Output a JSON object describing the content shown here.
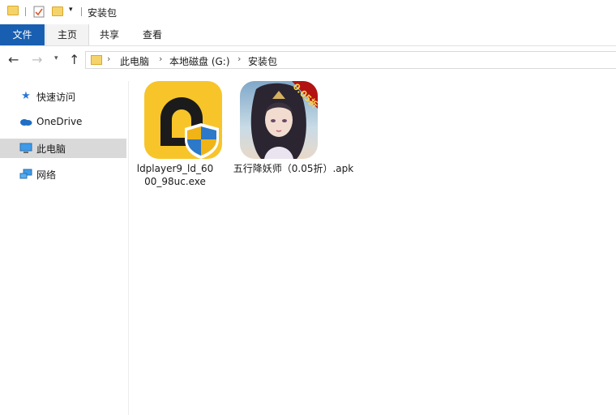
{
  "window": {
    "title": "安装包"
  },
  "ribbon": {
    "tabs": [
      "文件",
      "主页",
      "共享",
      "查看"
    ]
  },
  "address": {
    "crumbs": [
      "此电脑",
      "本地磁盘 (G:)",
      "安装包"
    ]
  },
  "sidebar": {
    "items": [
      {
        "label": "快速访问",
        "icon": "star-pin-icon"
      },
      {
        "label": "OneDrive",
        "icon": "cloud-icon"
      },
      {
        "label": "此电脑",
        "icon": "computer-icon",
        "selected": true
      },
      {
        "label": "网络",
        "icon": "network-icon"
      }
    ]
  },
  "files": [
    {
      "name": "ldplayer9_ld_6000_98uc.exe",
      "line1": "ldplayer9_ld_60",
      "line2": "00_98uc.exe",
      "icon": "ldplayer-app-icon"
    },
    {
      "name": "五行降妖师（0.05折）.apk",
      "line1": "五行降妖师（0.05折）.apk",
      "icon": "game-app-icon",
      "badge": "0.05折"
    }
  ],
  "colors": {
    "file_tab": "#195fb1",
    "selected_item": "#d9d9d9",
    "ld_yellow": "#f7c52a"
  }
}
